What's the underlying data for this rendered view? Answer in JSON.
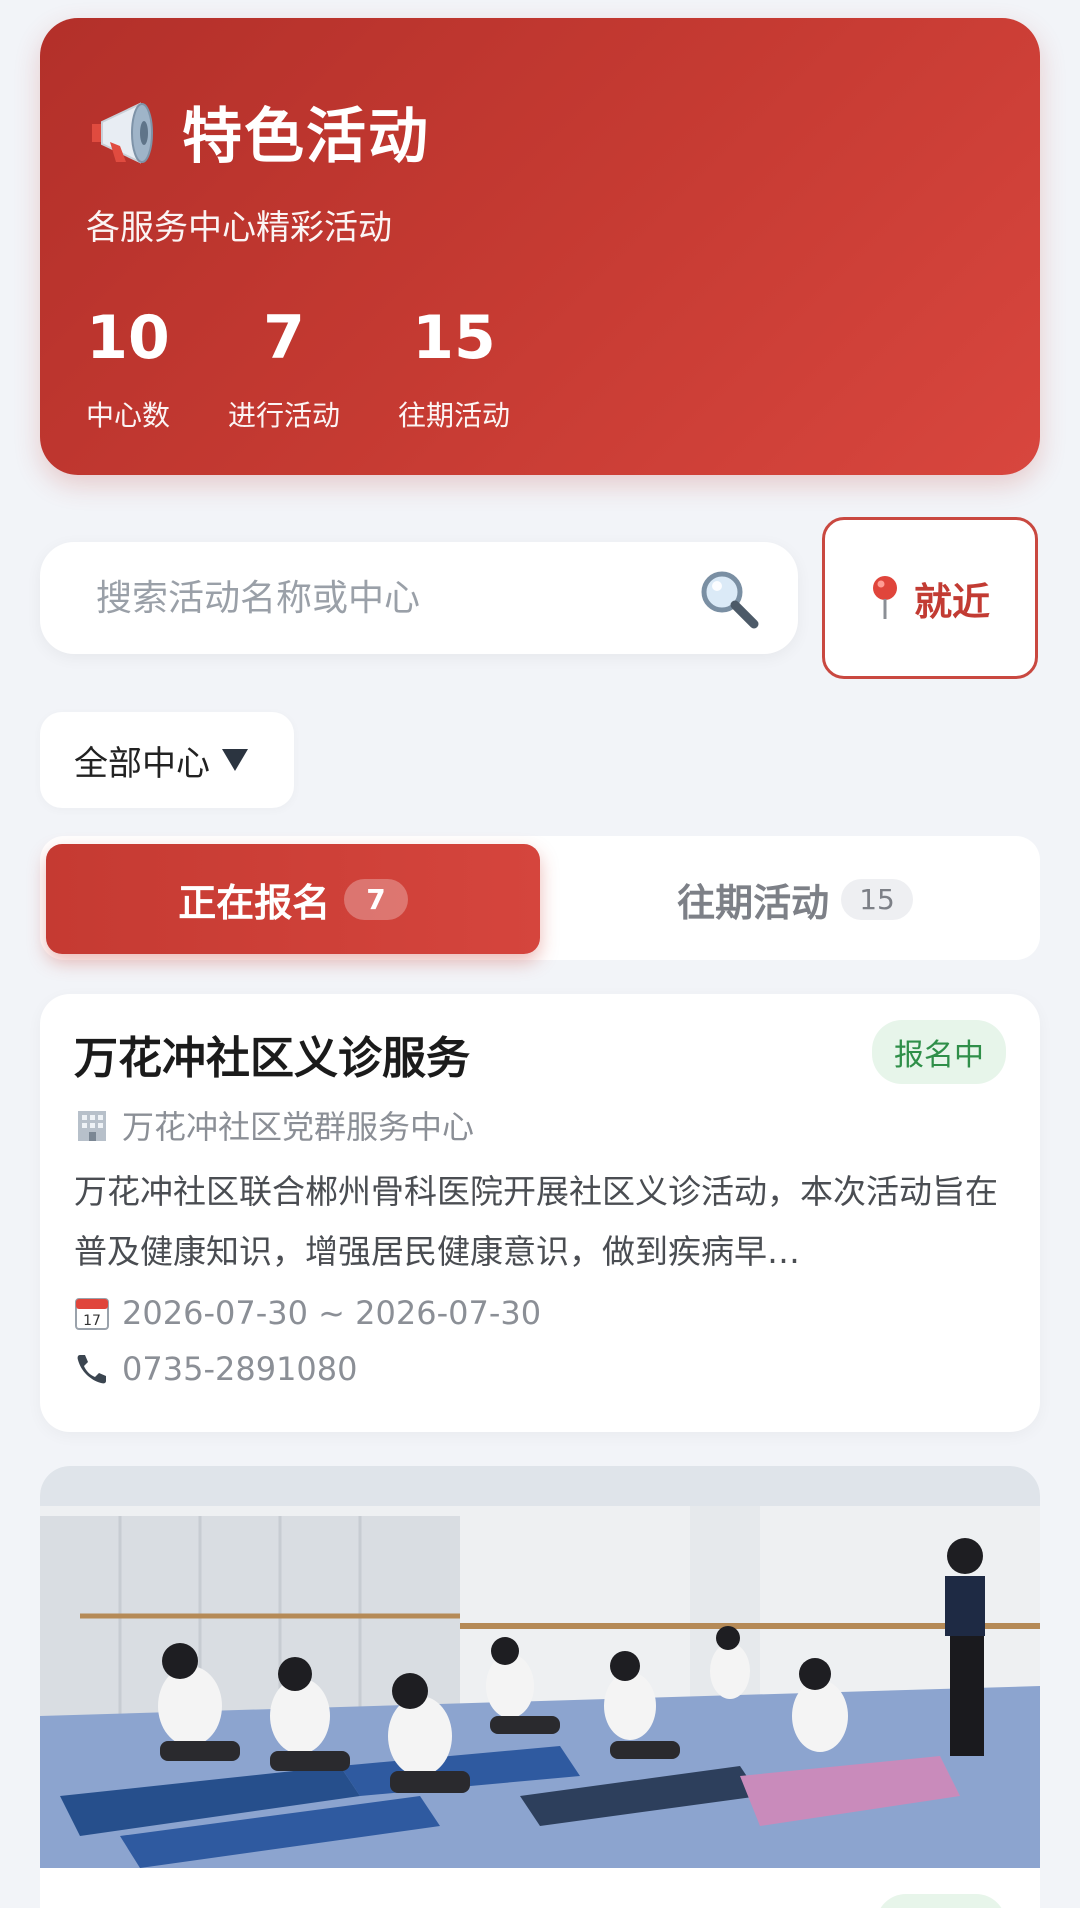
{
  "hero": {
    "title": "特色活动",
    "subtitle": "各服务中心精彩活动",
    "stats": [
      {
        "value": "10",
        "label": "中心数"
      },
      {
        "value": "7",
        "label": "进行活动"
      },
      {
        "value": "15",
        "label": "往期活动"
      }
    ],
    "icon": "megaphone-icon"
  },
  "search": {
    "placeholder": "搜索活动名称或中心",
    "value": "",
    "icon": "search-icon"
  },
  "nearby": {
    "label": "就近",
    "icon": "location-pin-icon"
  },
  "filter": {
    "selected": "全部中心",
    "icon": "chevron-down-icon"
  },
  "tabs": [
    {
      "label": "正在报名",
      "count": "7",
      "active": true
    },
    {
      "label": "往期活动",
      "count": "15",
      "active": false
    }
  ],
  "activities": [
    {
      "title": "万花冲社区义诊服务",
      "status": "报名中",
      "center": "万花冲社区党群服务中心",
      "description": "万花冲社区联合郴州骨科医院开展社区义诊活动，本次活动旨在普及健康知识，增强居民健康意识，做到疾病早…",
      "date_range": "2026-07-30 ~ 2026-07-30",
      "phone": "0735-2891080"
    }
  ],
  "colors": {
    "brand": "#c53a32",
    "status_green": "#2f8f49",
    "background": "#f2f4f8"
  }
}
